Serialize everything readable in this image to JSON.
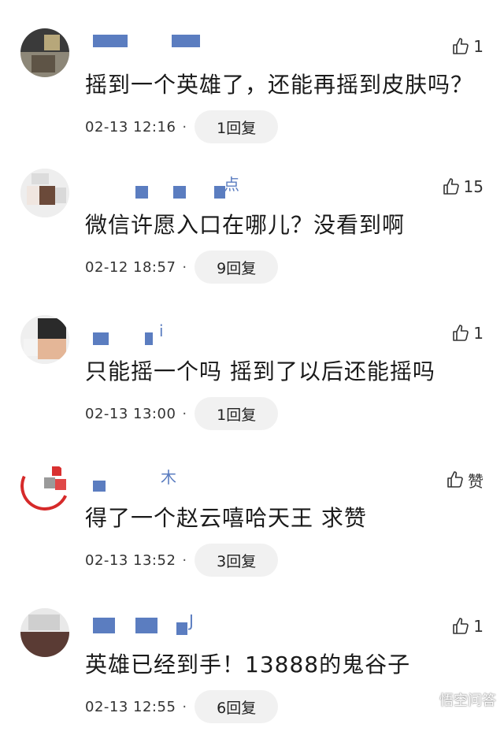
{
  "comments": [
    {
      "text": "摇到一个英雄了，还能再摇到皮肤吗？",
      "time": "02-13 12:16",
      "separator": "·",
      "reply": "1回复",
      "likes": "1"
    },
    {
      "text": "微信许愿入口在哪儿？没看到啊",
      "time": "02-12 18:57",
      "separator": "·",
      "reply": "9回复",
      "likes": "15"
    },
    {
      "text": "只能摇一个吗 摇到了以后还能摇吗",
      "time": "02-13 13:00",
      "separator": "·",
      "reply": "1回复",
      "likes": "1"
    },
    {
      "text": "得了一个赵云嘻哈天王  求赞",
      "time": "02-13 13:52",
      "separator": "·",
      "reply": "3回复",
      "likes": "赞"
    },
    {
      "text": "英雄已经到手！13888的鬼谷子",
      "time": "02-13 12:55",
      "separator": "·",
      "reply": "6回复",
      "likes": "1"
    }
  ],
  "name_fragments": [
    "点",
    "i",
    "木",
    "J"
  ],
  "icons": {
    "like": "thumbs-up-icon",
    "watermark": "chat-bubble-icon"
  },
  "watermark": "悟空问答",
  "colors": {
    "name_blue": "#5b7dc0",
    "text": "#1a1a1a",
    "reply_bg": "#f1f1f1"
  }
}
